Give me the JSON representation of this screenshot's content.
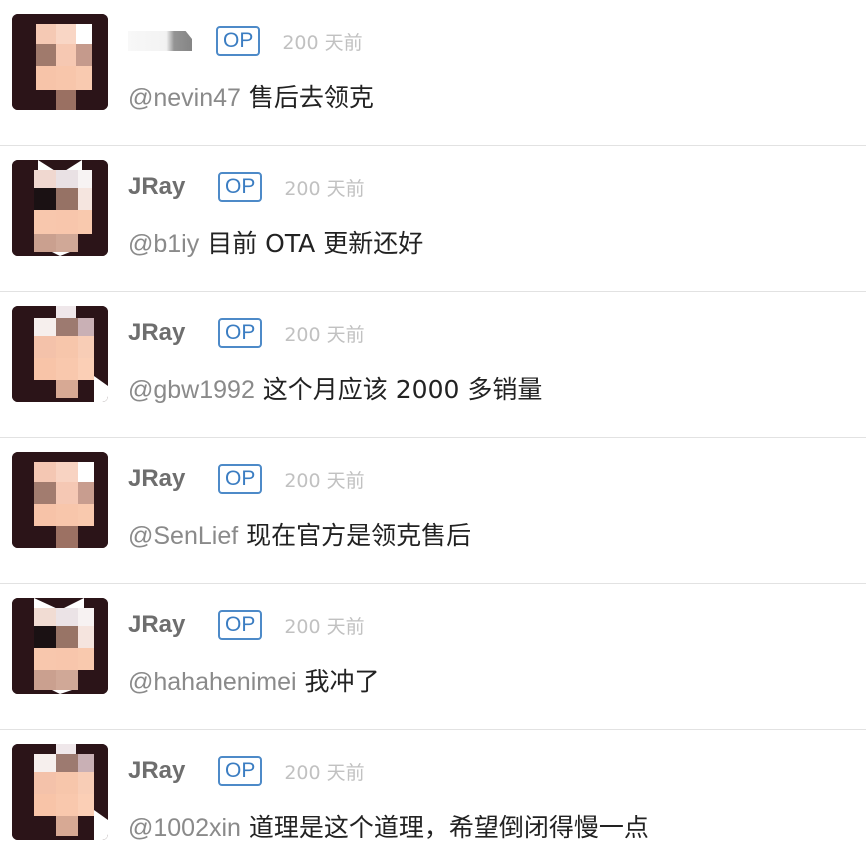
{
  "comments": [
    {
      "username": "",
      "username_hidden": true,
      "op_label": "OP",
      "time": "200 天前",
      "mention": "@nevin47",
      "text": " 售后去领克"
    },
    {
      "username": "JRay",
      "op_label": "OP",
      "time": "200 天前",
      "mention": "@b1iy",
      "text": " 目前 OTA 更新还好"
    },
    {
      "username": "JRay",
      "op_label": "OP",
      "time": "200 天前",
      "mention": "@gbw1992",
      "text": " 这个月应该 2000 多销量"
    },
    {
      "username": "JRay",
      "op_label": "OP",
      "time": "200 天前",
      "mention": "@SenLief",
      "text": " 现在官方是领克售后"
    },
    {
      "username": "JRay",
      "op_label": "OP",
      "time": "200 天前",
      "mention": "@hahahenimei",
      "text": " 我冲了"
    },
    {
      "username": "JRay",
      "op_label": "OP",
      "time": "200 天前",
      "mention": "@1002xin",
      "text": " 道理是这个道理，希望倒闭得慢一点"
    }
  ],
  "colors": {
    "op_badge": "#3b7dc2",
    "mention": "#8a8a8a",
    "time": "#c1c1c1",
    "divider": "#e2e2e2"
  },
  "icons": {
    "avatar": "pixelated-avatar-icon"
  }
}
